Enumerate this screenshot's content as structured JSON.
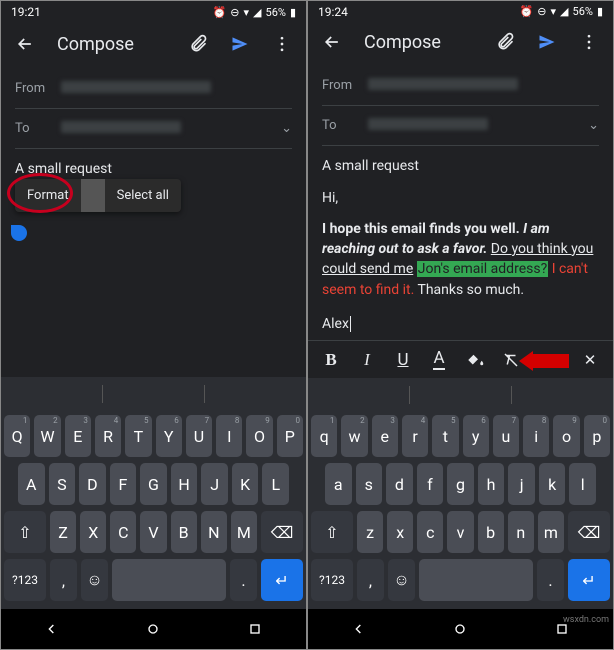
{
  "left": {
    "status": {
      "time": "19:21",
      "battery": "56%"
    },
    "title": "Compose",
    "from_label": "From",
    "to_label": "To",
    "from_value": "",
    "to_value": "",
    "subject": "A small request",
    "ctx": {
      "format": "Format",
      "selectall": "Select all"
    },
    "suggest": [
      "",
      "",
      ""
    ],
    "bottom": {
      "sym": "?123",
      "comma": ",",
      "period": "."
    },
    "krow1": [
      "Q",
      "W",
      "E",
      "R",
      "T",
      "Y",
      "U",
      "I",
      "O",
      "P"
    ],
    "krow2": [
      "A",
      "S",
      "D",
      "F",
      "G",
      "H",
      "J",
      "K",
      "L"
    ],
    "krow3": [
      "Z",
      "X",
      "C",
      "V",
      "B",
      "N",
      "M"
    ],
    "hints": [
      "1",
      "2",
      "3",
      "4",
      "5",
      "6",
      "7",
      "8",
      "9",
      "0"
    ]
  },
  "right": {
    "status": {
      "time": "19:24",
      "battery": "56%"
    },
    "title": "Compose",
    "from_label": "From",
    "to_label": "To",
    "from_value": "",
    "to_value": "",
    "subject": "A small request",
    "body": {
      "greeting": "Hi,",
      "p1_bold": "I hope this email finds you well.",
      "p1_bolditalic": "I am reaching out to ask a favor.",
      "p1_underline": "Do you think you could send me",
      "p1_green": "Jon's email address?",
      "p1_red": "I can't seem to find it.",
      "p1_plain": "Thanks so much.",
      "sign": "Alex"
    },
    "fmt": {
      "bold": "B",
      "italic": "I",
      "underline": "U",
      "color": "A",
      "fill": "",
      "clear": "",
      "close": "✕"
    },
    "bottom": {
      "sym": "?123",
      "comma": ",",
      "period": "."
    },
    "krow1": [
      "q",
      "w",
      "e",
      "r",
      "t",
      "y",
      "u",
      "i",
      "o",
      "p"
    ],
    "krow2": [
      "a",
      "s",
      "d",
      "f",
      "g",
      "h",
      "j",
      "k",
      "l"
    ],
    "krow3": [
      "z",
      "x",
      "c",
      "v",
      "b",
      "n",
      "m"
    ],
    "hints": [
      "1",
      "2",
      "3",
      "4",
      "5",
      "6",
      "7",
      "8",
      "9",
      "0"
    ]
  },
  "watermark": "wsxdn.com"
}
